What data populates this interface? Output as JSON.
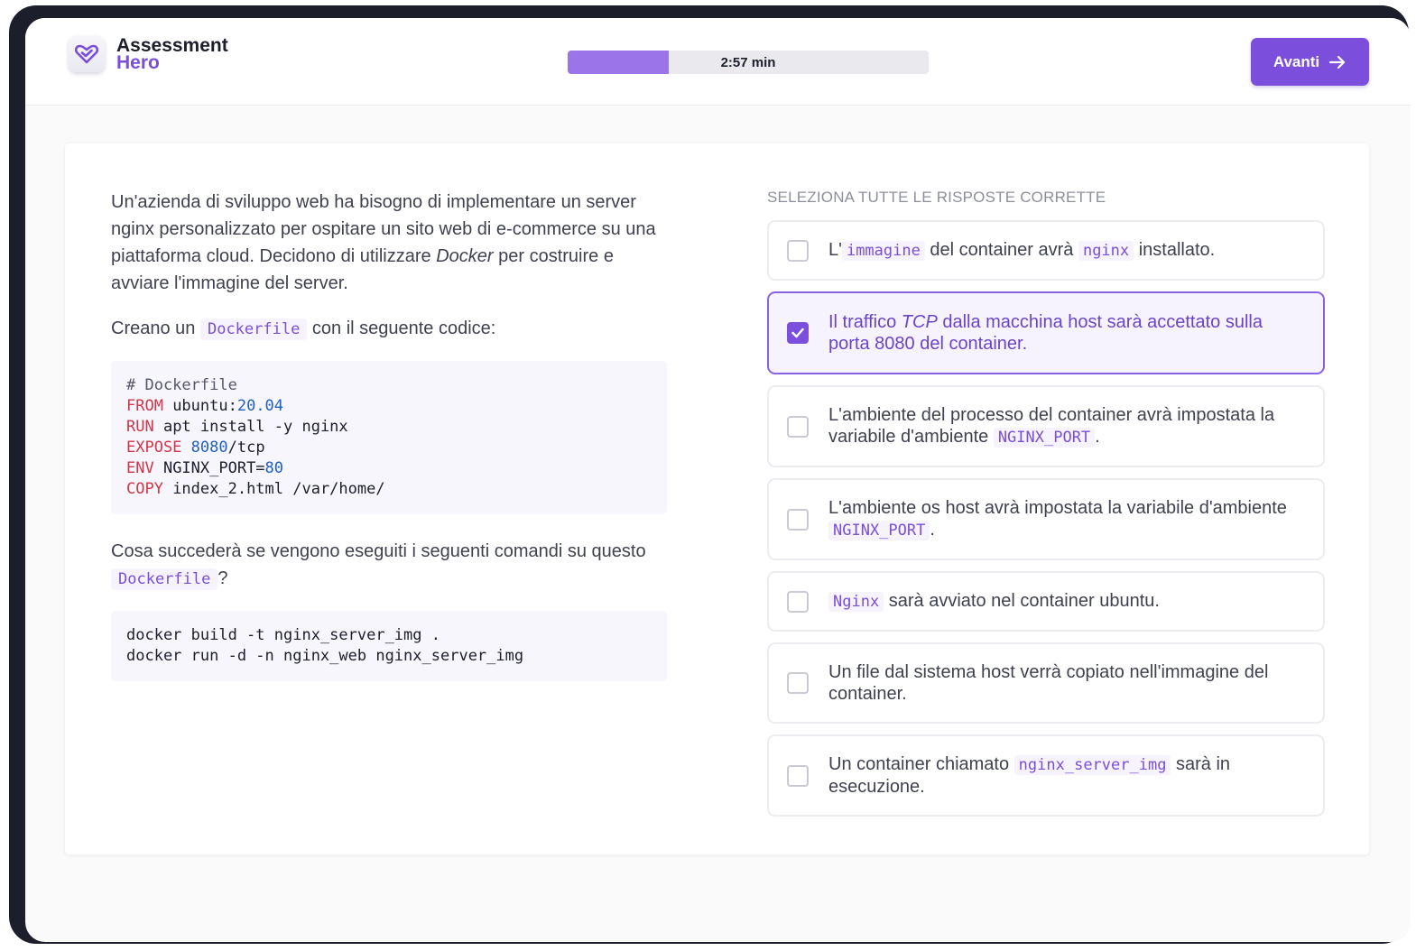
{
  "brand": {
    "line1": "Assessment",
    "line2": "Hero"
  },
  "timer": {
    "label": "2:57 min",
    "progress_fraction": 0.28
  },
  "next_button": {
    "label": "Avanti"
  },
  "question": {
    "intro_parts": [
      "Un'azienda di sviluppo web ha bisogno di implementare un server nginx personalizzato per ospitare un sito web di e-commerce su una piattaforma cloud. Decidono di utilizzare ",
      "Docker",
      " per costruire e avviare l'immagine del server."
    ],
    "line2_before": "Creano un",
    "line2_code": "Dockerfile",
    "line2_after": "con il seguente codice:",
    "dockerfile": {
      "comment": "# Dockerfile",
      "l1_kw": "FROM",
      "l1_rest": " ubuntu:",
      "l1_num": "20.04",
      "l2_kw": "RUN",
      "l2_rest": " apt install -y nginx",
      "l3_kw": "EXPOSE",
      "l3_num": " 8080",
      "l3_rest": "/tcp",
      "l4_kw": "ENV",
      "l4_rest": " NGINX_PORT=",
      "l4_num": "80",
      "l5_kw": "COPY",
      "l5_rest": " index_2.html /var/home/"
    },
    "q_before": "Cosa succederà se vengono eseguiti i seguenti comandi su questo",
    "q_code": "Dockerfile",
    "q_after": "?",
    "commands": [
      "docker build -t nginx_server_img .",
      "docker run -d -n nginx_web nginx_server_img"
    ]
  },
  "answers": {
    "instruction": "SELEZIONA TUTTE LE RISPOSTE CORRETTE",
    "options": [
      {
        "p1": "L'",
        "c1": "immagine",
        "p2": " del container avrà ",
        "c2": "nginx",
        "p3": " installato.",
        "checked": false
      },
      {
        "p1": "Il traffico ",
        "em": "TCP",
        "p2": " dalla macchina host sarà accettato sulla porta 8080 del container.",
        "checked": true
      },
      {
        "p1": "L'ambiente del processo del container avrà impostata la variabile d'ambiente ",
        "c1": "NGINX_PORT",
        "p2": ".",
        "checked": false
      },
      {
        "p1": "L'ambiente os host avrà impostata la variabile d'ambiente ",
        "c1": "NGINX_PORT",
        "p2": ".",
        "checked": false
      },
      {
        "c1": "Nginx",
        "p1": " sarà avviato nel container ubuntu.",
        "checked": false
      },
      {
        "p1": "Un file dal sistema host verrà copiato nell'immagine del container.",
        "checked": false
      },
      {
        "p1": "Un container chiamato ",
        "c1": "nginx_server_img",
        "p2": " sarà in esecuzione.",
        "checked": false
      }
    ]
  },
  "icons": {
    "logo": "heart-check-logo-icon",
    "next": "arrow-right-icon",
    "check": "check-icon"
  },
  "colors": {
    "accent": "#7b4fdb",
    "progress": "#9b74ea",
    "code_keyword": "#d03648",
    "code_number": "#1f5fbf"
  }
}
